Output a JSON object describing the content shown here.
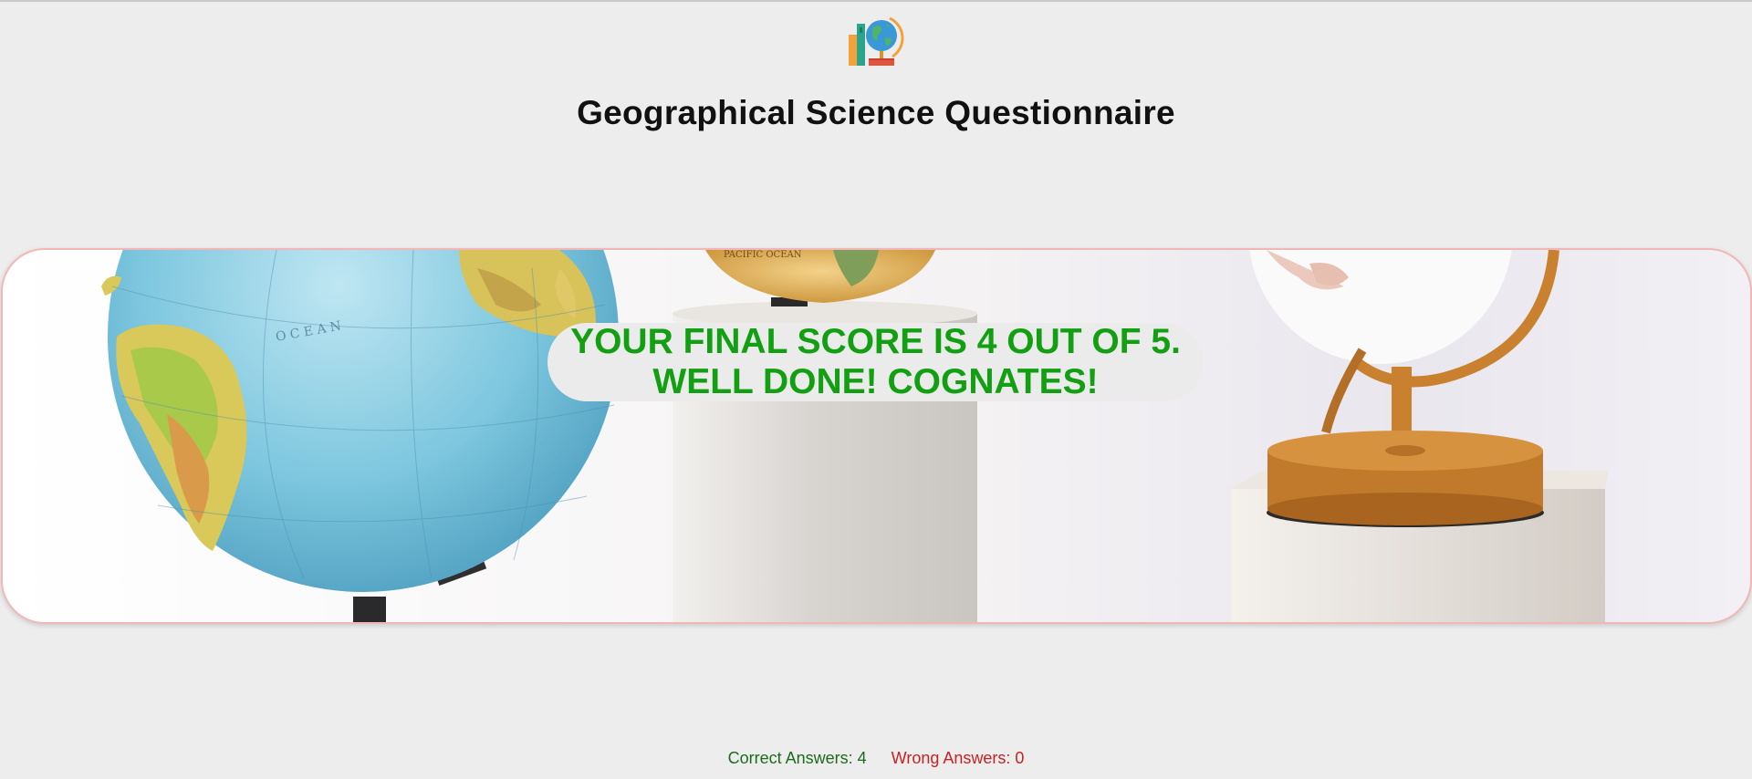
{
  "header": {
    "logo_icon": "books-and-globe-icon",
    "title": "Geographical Science Questionnaire"
  },
  "banner": {
    "image": "globes-on-pedestals-photo",
    "score_line_1": "YOUR FINAL SCORE IS 4 OUT OF 5.",
    "score_line_2": "WELL DONE! COGNATES!",
    "score_color": "#12a012"
  },
  "footer": {
    "correct_label": "Correct Answers: 4",
    "wrong_label": "Wrong Answers: 0",
    "correct_color": "#1e6a1e",
    "wrong_color": "#c62222"
  }
}
